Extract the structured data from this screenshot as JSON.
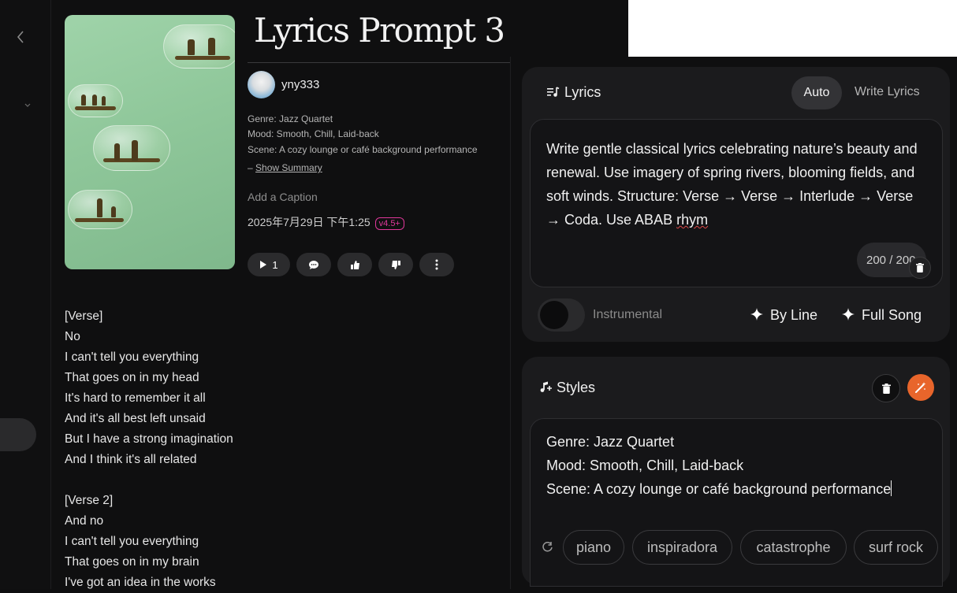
{
  "nav": {
    "back_icon": "chevron-left-icon",
    "expand_icon": "chevron-down-icon"
  },
  "song": {
    "title": "Lyrics Prompt 3",
    "author": "yny333",
    "genre_line": "Genre: Jazz Quartet",
    "mood_line": "Mood: Smooth, Chill, Laid-back",
    "scene_line": "Scene: A cozy lounge or café background performance",
    "show_summary_prefix": "– ",
    "show_summary_label": "Show Summary",
    "caption_placeholder": "Add a Caption",
    "date": "2025年7月29日 下午1:25",
    "version_badge": "v4.5+",
    "version_color": "#e0389b",
    "play_count": "1"
  },
  "lyrics_lines": [
    "[Verse]",
    "No",
    "I can't tell you everything",
    "That goes on in my head",
    "It's hard to remember it all",
    "And it's all best left unsaid",
    "But I have a strong imagination",
    "And I think it's all related",
    "",
    "[Verse 2]",
    "And no",
    "I can't tell you everything",
    "That goes on in my brain",
    "I've got an idea in the works"
  ],
  "lyrics_panel": {
    "title": "Lyrics",
    "mode_auto": "Auto",
    "mode_write": "Write Lyrics",
    "prompt_text": "Write gentle classical lyrics celebrating nature’s beauty and renewal. Use imagery of spring rivers, blooming fields, and soft winds. Structure: Verse → Verse → Interlude → Verse → Coda. Use ABAB ",
    "prompt_misspelled": "rhym",
    "char_count": "200 / 200",
    "instrumental_label": "Instrumental",
    "by_line_label": "By Line",
    "full_song_label": "Full Song"
  },
  "styles_panel": {
    "title": "Styles",
    "line1": "Genre: Jazz Quartet",
    "line2": "Mood: Smooth, Chill, Laid-back",
    "line3": "Scene: A cozy lounge or café background performance",
    "chips": [
      "piano",
      "inspiradora",
      "catastrophe",
      "surf rock"
    ],
    "magic_color": "#e8652b"
  }
}
